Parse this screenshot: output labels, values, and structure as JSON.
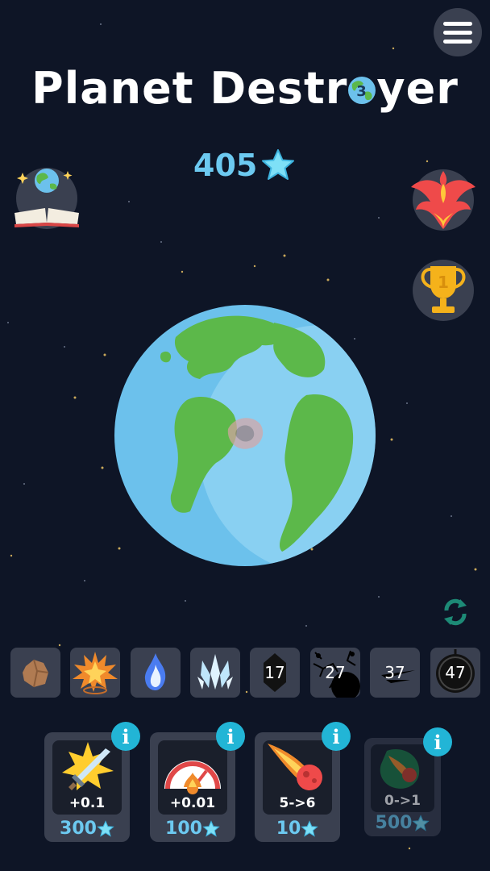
{
  "title": {
    "before": "Planet Destr",
    "after": "yer",
    "planet_badge": "3"
  },
  "score": {
    "value": "405",
    "icon": "star-icon"
  },
  "colors": {
    "background": "#0e1526",
    "accent": "#6cc9f0",
    "panel": "#3a4050",
    "info": "#22b5d6",
    "land": "#5cb84a",
    "ocean": "#6cc1ec"
  },
  "elements": [
    {
      "name": "rock",
      "label": ""
    },
    {
      "name": "explosion",
      "label": ""
    },
    {
      "name": "blue-fire",
      "label": ""
    },
    {
      "name": "ice-crystal",
      "label": ""
    },
    {
      "name": "dark-crystal",
      "label": "17"
    },
    {
      "name": "black-hole-cracks",
      "label": "27"
    },
    {
      "name": "dark-slash",
      "label": "37"
    },
    {
      "name": "dark-orb",
      "label": "47"
    }
  ],
  "upgrades": [
    {
      "name": "sword",
      "effect": "+0.1",
      "cost": "300"
    },
    {
      "name": "speedometer",
      "effect": "+0.01",
      "cost": "100"
    },
    {
      "name": "meteor",
      "effect": "5->6",
      "cost": "10"
    },
    {
      "name": "green-meteor",
      "effect": "0->1",
      "cost": "500"
    }
  ],
  "info_label": "i"
}
